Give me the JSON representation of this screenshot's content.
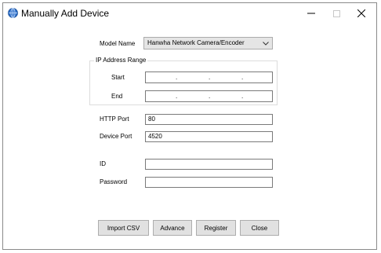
{
  "window": {
    "title": "Manually Add Device",
    "controls": [
      "minimize",
      "maximize",
      "close"
    ]
  },
  "form": {
    "model_name_label": "Model Name",
    "model_name_value": "Hanwha Network Camera/Encoder",
    "ip_range_label": "IP Address Range",
    "start_label": "Start",
    "end_label": "End",
    "ip_separator": ".",
    "http_port_label": "HTTP Port",
    "http_port_value": "80",
    "device_port_label": "Device Port",
    "device_port_value": "4520",
    "id_label": "ID",
    "id_value": "",
    "password_label": "Password",
    "password_value": ""
  },
  "buttons": {
    "import_csv": "Import CSV",
    "advance": "Advance",
    "register": "Register",
    "close": "Close"
  },
  "icons": {
    "app": "globe-app-icon",
    "dropdown": "chevron-down-icon"
  },
  "colors": {
    "button_bg": "#e1e1e1",
    "border": "#7a7a7a",
    "select_bg": "#e5e5e5"
  }
}
